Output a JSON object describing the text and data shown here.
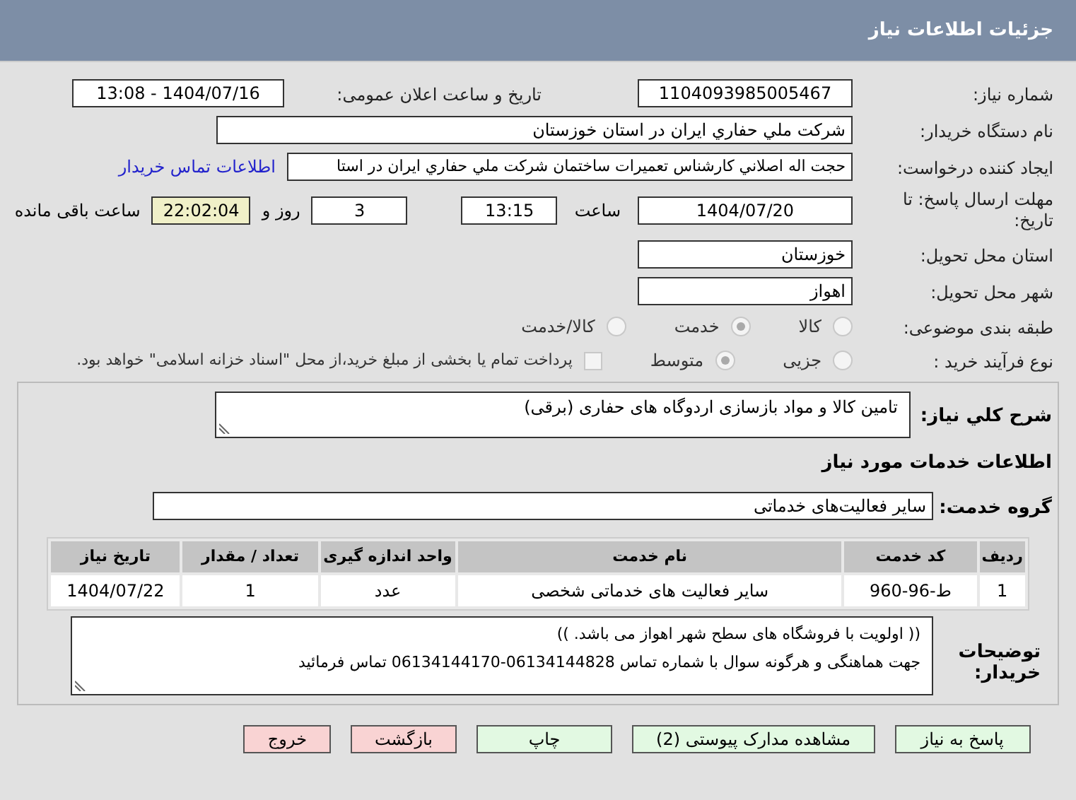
{
  "header": {
    "title": "جزئیات اطلاعات نیاز"
  },
  "need_number": {
    "label": "شماره نیاز:",
    "value": "1104093985005467"
  },
  "announce": {
    "label": "تاریخ و ساعت اعلان عمومی:",
    "value": "1404/07/16 - 13:08"
  },
  "buyer": {
    "label": "نام دستگاه خریدار:",
    "value": "شرکت ملي حفاري ايران در استان خوزستان"
  },
  "creator": {
    "label": "ایجاد کننده درخواست:",
    "value": "حجت اله اصلاني کارشناس تعميرات ساختمان شرکت ملي حفاري ايران در استا",
    "link": "اطلاعات تماس خریدار"
  },
  "deadline": {
    "label": "مهلت ارسال پاسخ: تا تاریخ:",
    "date": "1404/07/20",
    "time_label": "ساعت",
    "time": "13:15",
    "days": "3",
    "days_label": "روز و",
    "remaining": "22:02:04",
    "remaining_label": "ساعت باقی مانده"
  },
  "province": {
    "label": "استان محل تحویل:",
    "value": "خوزستان"
  },
  "city": {
    "label": "شهر محل تحویل:",
    "value": "اهواز"
  },
  "category": {
    "label": "طبقه بندی موضوعی:",
    "options": [
      {
        "label": "کالا",
        "selected": false
      },
      {
        "label": "خدمت",
        "selected": true
      },
      {
        "label": "کالا/خدمت",
        "selected": false
      }
    ]
  },
  "purchase_type": {
    "label": "نوع فرآیند خرید :",
    "options": [
      {
        "label": "جزیی",
        "selected": false
      },
      {
        "label": "متوسط",
        "selected": true
      }
    ],
    "payment": {
      "checked": false,
      "text": "پرداخت تمام یا بخشی از مبلغ خرید،از محل \"اسناد خزانه اسلامی\" خواهد بود."
    }
  },
  "description": {
    "label": "شرح کلي نياز:",
    "value": "تامین کالا و مواد بازسازی اردوگاه های حفاری (برقی)"
  },
  "services_title": "اطلاعات خدمات مورد نیاز",
  "service_group": {
    "label": "گروه خدمت:",
    "value": "سایر فعالیت‌های خدماتی"
  },
  "table": {
    "columns": [
      "ردیف",
      "کد خدمت",
      "نام خدمت",
      "واحد اندازه گیری",
      "تعداد / مقدار",
      "تاریخ نیاز"
    ],
    "rows": [
      [
        "1",
        "ط-96-960",
        "سایر فعالیت های خدماتی شخصی",
        "عدد",
        "1",
        "1404/07/22"
      ]
    ]
  },
  "buyer_notes": {
    "label": "توضیحات خریدار:",
    "lines": [
      "((  اولویت با فروشگاه های سطح شهر اهواز می باشد. ))",
      "جهت هماهنگی و هرگونه سوال با شماره تماس 06134144828-06134144170 تماس فرمائید"
    ]
  },
  "buttons": [
    {
      "label": "پاسخ به نیاز",
      "kind": "normal"
    },
    {
      "label": "مشاهده مدارک پیوستی (2)",
      "kind": "normal"
    },
    {
      "label": "چاپ",
      "kind": "normal"
    },
    {
      "label": "بازگشت",
      "kind": "exit"
    },
    {
      "label": "خروج",
      "kind": "exit"
    }
  ]
}
